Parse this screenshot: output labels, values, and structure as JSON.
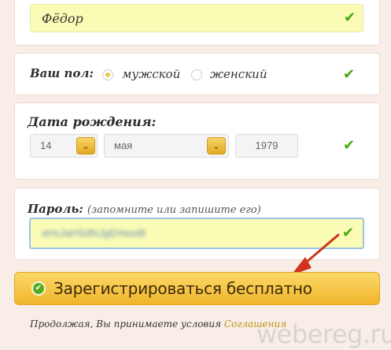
{
  "name": {
    "value": "Фёдор"
  },
  "gender": {
    "label": "Ваш пол:",
    "male": "мужской",
    "female": "женский",
    "selected": "мужской"
  },
  "birthdate": {
    "label": "Дата рождения:",
    "day": "14",
    "month": "мая",
    "year": "1979"
  },
  "password": {
    "label": "Пароль:",
    "hint": "(запомните или запишите его)",
    "value": "aHsJaHSdfsJgEHasd8"
  },
  "submit": {
    "label": "Зарегистрироваться бесплатно"
  },
  "terms": {
    "text": "Продолжая, Вы принимаете условия ",
    "link": "Соглашения"
  },
  "watermark": "webereg.ru",
  "colors": {
    "accent": "#f1b52c",
    "check": "#46a80d",
    "field_highlight": "#fafcb5",
    "arrow": "#d0321e"
  }
}
